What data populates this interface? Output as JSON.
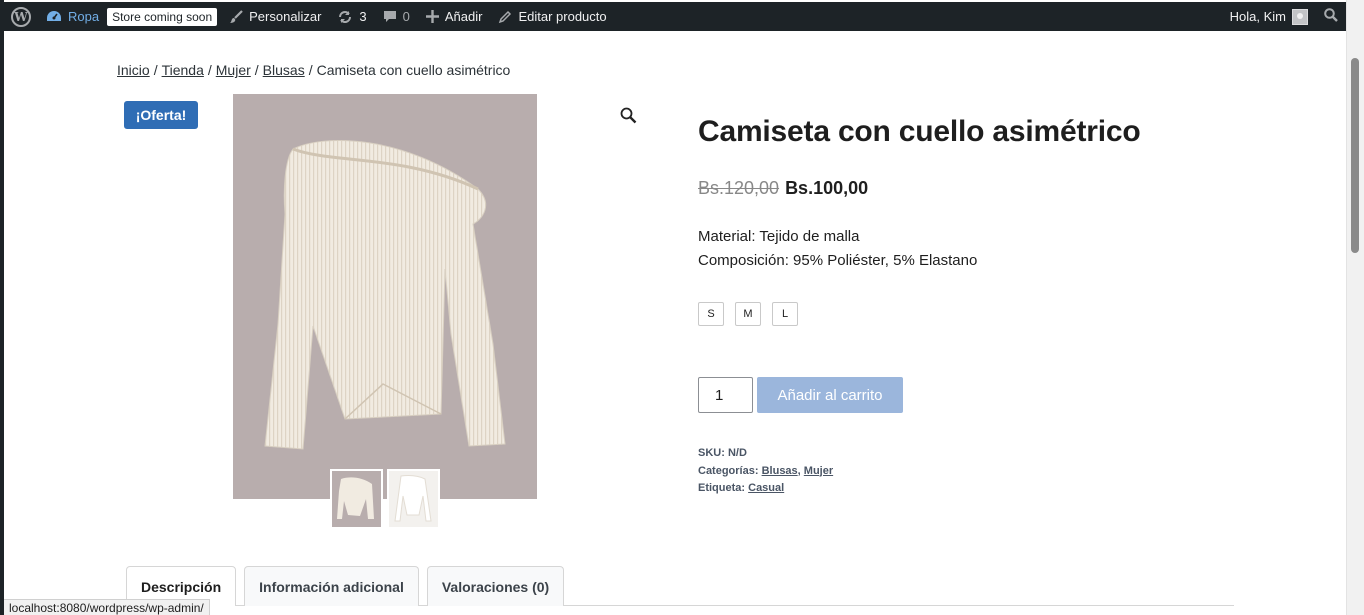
{
  "adminbar": {
    "site_name": "Ropa",
    "coming_soon": "Store coming soon",
    "customize": "Personalizar",
    "updates_count": "3",
    "comments_count": "0",
    "add_new": "Añadir",
    "edit_product": "Editar producto",
    "greeting": "Hola, Kim"
  },
  "breadcrumb": {
    "items": [
      "Inicio",
      "Tienda",
      "Mujer",
      "Blusas"
    ],
    "separator": "/",
    "current": "Camiseta con cuello asimétrico"
  },
  "product": {
    "sale_badge": "¡Oferta!",
    "title": "Camiseta con cuello asimétrico",
    "price_old": "Bs.120,00",
    "price_new": "Bs.100,00",
    "description": [
      "Material: Tejido de malla",
      "Composición: 95% Poliéster, 5% Elastano"
    ],
    "sizes": [
      "S",
      "M",
      "L"
    ],
    "quantity": "1",
    "add_to_cart": "Añadir al carrito",
    "meta": {
      "sku_label": "SKU:",
      "sku_value": "N/D",
      "categories_label": "Categorías:",
      "categories": [
        "Blusas",
        "Mujer"
      ],
      "tag_label": "Etiqueta:",
      "tag": "Casual"
    }
  },
  "tabs": [
    {
      "label": "Descripción",
      "active": true
    },
    {
      "label": "Información adicional",
      "active": false
    },
    {
      "label": "Valoraciones (0)",
      "active": false
    }
  ],
  "status_bar": {
    "url": "localhost:8080/wordpress/wp-admin/"
  },
  "colors": {
    "admin_bar": "#1d2327",
    "sale_badge": "#2f6db5",
    "add_to_cart": "#9bb6dc",
    "image_bg": "#b8adad"
  }
}
